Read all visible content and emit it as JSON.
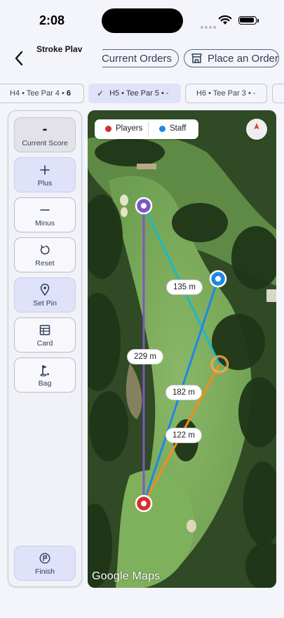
{
  "status_bar": {
    "time": "2:08"
  },
  "header": {
    "title": "Stroke Plav",
    "current_orders_label": "Current Orders",
    "place_order_label": "Place an Order"
  },
  "hole_tabs": [
    {
      "text": "H4 • Tee Par 4 •",
      "score": "6",
      "selected": false
    },
    {
      "text": "H5 • Tee Par 5 • -",
      "selected": true
    },
    {
      "text": "H6 • Tee Par 3 • -",
      "selected": false
    }
  ],
  "actions": {
    "current_score": {
      "value": "-",
      "label": "Current Score"
    },
    "plus": "Plus",
    "minus": "Minus",
    "reset": "Reset",
    "set_pin": "Set Pin",
    "card": "Card",
    "bag": "Bag",
    "finish": "Finish"
  },
  "map": {
    "legend": {
      "players_label": "Players",
      "players_color": "#d32f2f",
      "staff_label": "Staff",
      "staff_color": "#1e88e5"
    },
    "distances": {
      "pin_to_staff": "135 m",
      "player_to_pin": "229 m",
      "player_to_staff": "182 m",
      "player_to_target": "122 m"
    },
    "attribution": "Google Maps"
  },
  "colors": {
    "accent": "#dfe2f9",
    "header_text": "#2f3e57",
    "player_marker": "#d32f2f",
    "pin_marker": "#7e57c2",
    "staff_marker": "#1e88e5",
    "target_marker": "#f29a2e",
    "line_player_pin": "#7e57c2",
    "line_pin_target": "#1fb7c8",
    "line_player_staff": "#1e88e5",
    "line_player_target": "#f28c1e"
  }
}
